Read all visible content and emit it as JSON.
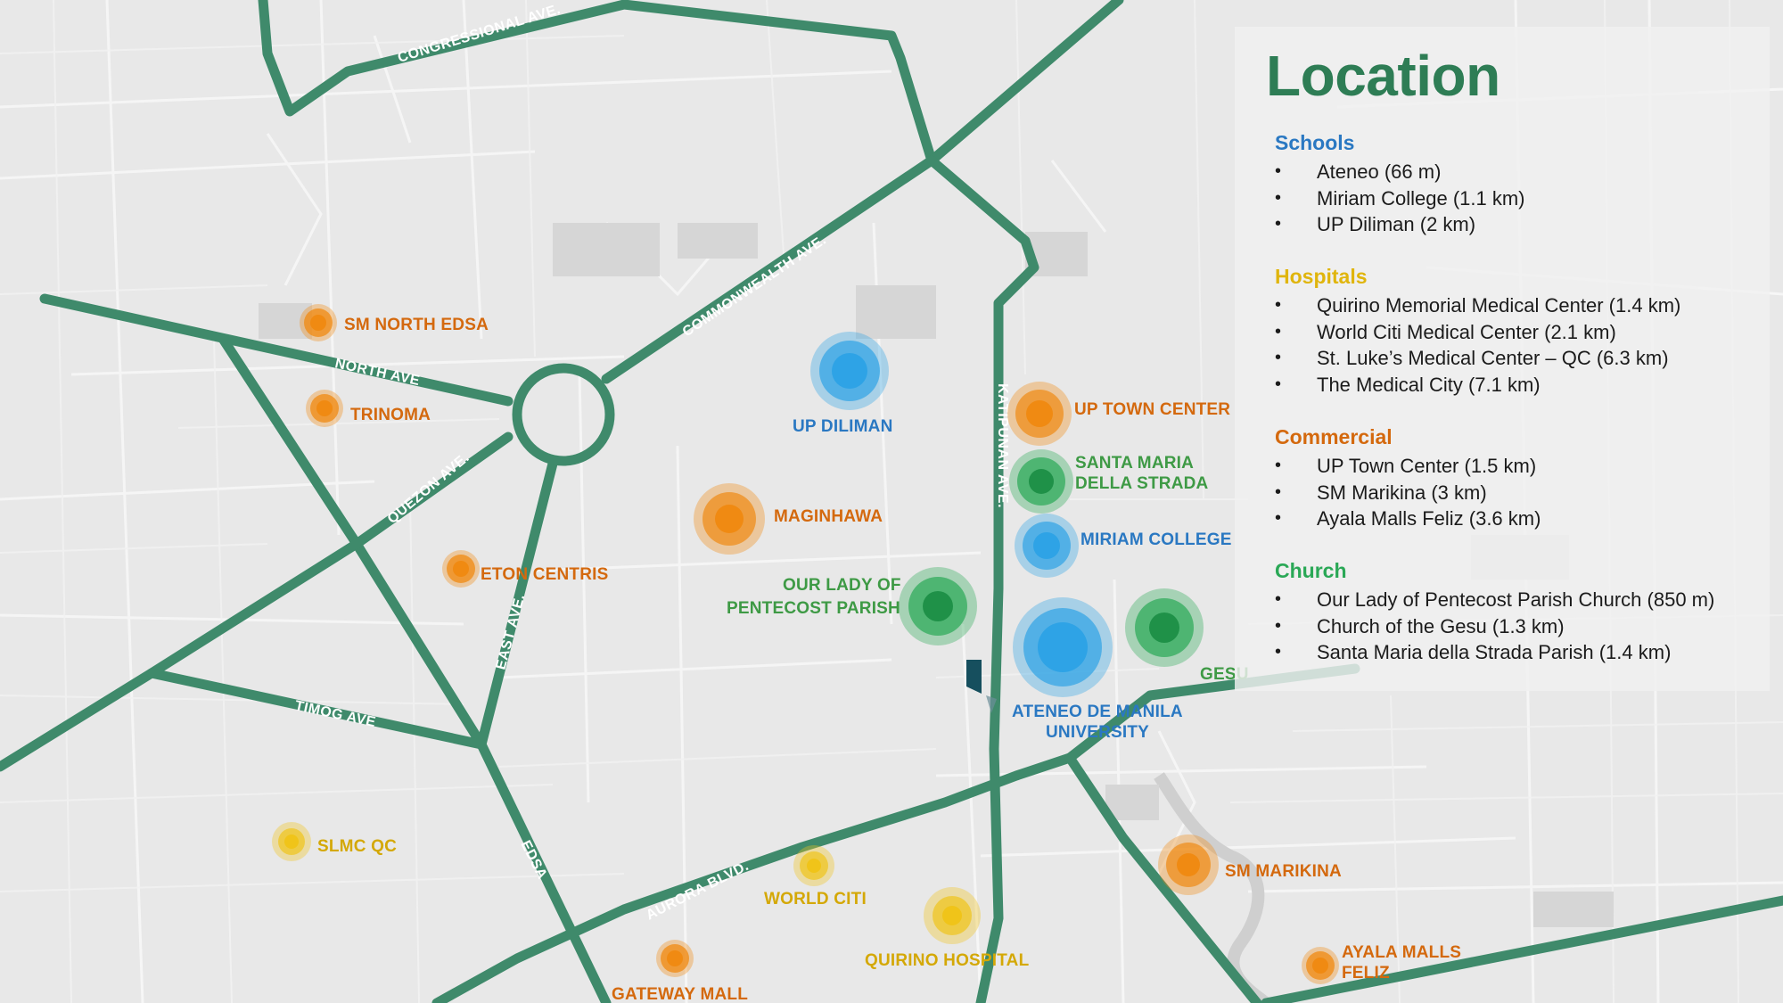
{
  "map": {
    "roads": [
      {
        "id": "congressional",
        "label": "CONGRESSIONAL AVE."
      },
      {
        "id": "commonwealth",
        "label": "COMMONWEALTH AVE."
      },
      {
        "id": "north",
        "label": "NORTH AVE"
      },
      {
        "id": "quezon",
        "label": "QUEZON AVE."
      },
      {
        "id": "east",
        "label": "EAST AVE."
      },
      {
        "id": "timog",
        "label": "TIMOG AVE"
      },
      {
        "id": "edsa",
        "label": "EDSA"
      },
      {
        "id": "aurora",
        "label": "AURORA BLVD."
      },
      {
        "id": "katipunan",
        "label": "KATIPUNAN AVE."
      }
    ],
    "pois": [
      {
        "label": "SM NORTH EDSA",
        "category": "commercial"
      },
      {
        "label": "TRINOMA",
        "category": "commercial"
      },
      {
        "label": "ETON CENTRIS",
        "category": "commercial"
      },
      {
        "label": "MAGINHAWA",
        "category": "commercial"
      },
      {
        "label": "UP DILIMAN",
        "category": "school"
      },
      {
        "label": "UP TOWN CENTER",
        "category": "commercial"
      },
      {
        "label": "SANTA MARIA",
        "category": "church"
      },
      {
        "label": "DELLA STRADA",
        "category": "church"
      },
      {
        "label": "MIRIAM COLLEGE",
        "category": "school"
      },
      {
        "label": "OUR LADY OF",
        "category": "church"
      },
      {
        "label": "PENTECOST PARISH",
        "category": "church"
      },
      {
        "label": "GESU",
        "category": "church"
      },
      {
        "label": "ATENEO DE MANILA",
        "category": "school"
      },
      {
        "label": "UNIVERSITY",
        "category": "school"
      },
      {
        "label": "SLMC QC",
        "category": "hospital"
      },
      {
        "label": "WORLD CITI",
        "category": "hospital"
      },
      {
        "label": "QUIRINO HOSPITAL",
        "category": "hospital"
      },
      {
        "label": "GATEWAY MALL",
        "category": "commercial"
      },
      {
        "label": "SM MARIKINA",
        "category": "commercial"
      },
      {
        "label": "AYALA MALLS",
        "category": "commercial"
      },
      {
        "label": "FELIZ",
        "category": "commercial"
      }
    ]
  },
  "panel": {
    "title": "Location",
    "sections": [
      {
        "heading": "Schools",
        "items": [
          "Ateneo (66 m)",
          "Miriam College (1.1 km)",
          "UP Diliman (2 km)"
        ]
      },
      {
        "heading": "Hospitals",
        "items": [
          "Quirino Memorial Medical Center (1.4 km)",
          "World Citi Medical Center (2.1 km)",
          "St. Luke’s Medical Center – QC (6.3 km)",
          "The Medical City (7.1 km)"
        ]
      },
      {
        "heading": "Commercial",
        "items": [
          "UP Town Center (1.5 km)",
          "SM Marikina (3 km)",
          "Ayala Malls Feliz (3.6 km)"
        ]
      },
      {
        "heading": "Church",
        "items": [
          "Our Lady of Pentecost Parish Church (850 m)",
          "Church of the Gesu (1.3 km)",
          "Santa Maria della Strada Parish (1.4 km)"
        ]
      }
    ]
  },
  "colors": {
    "road": "#3f8a6b",
    "school": "#2ea3e6",
    "hospital": "#f0c419",
    "commercial": "#f08a12",
    "church": "#2aa856",
    "title": "#2e7d55",
    "school_label": "#2a78c2",
    "hospital_label": "#d4a806",
    "commercial_label": "#d4690e",
    "church_label": "#3e9a45"
  }
}
